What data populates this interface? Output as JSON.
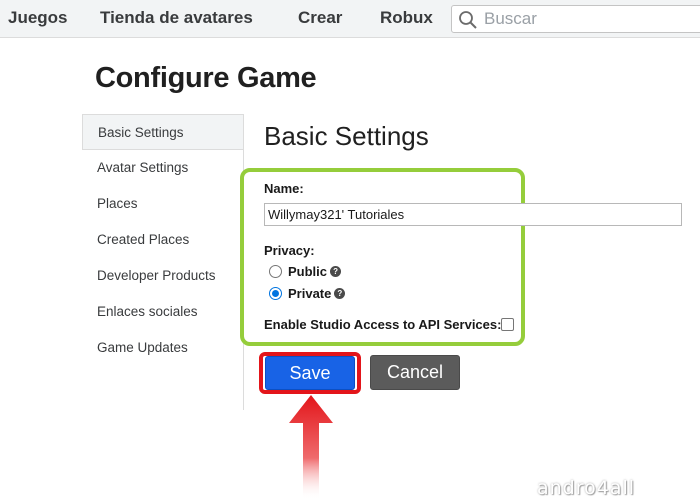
{
  "nav": {
    "items": [
      "Juegos",
      "Tienda de avatares",
      "Crear",
      "Robux"
    ],
    "search_placeholder": "Buscar"
  },
  "page_title": "Configure Game",
  "menu": {
    "items": [
      {
        "label": "Basic Settings",
        "active": true
      },
      {
        "label": "Avatar Settings",
        "active": false
      },
      {
        "label": "Places",
        "active": false
      },
      {
        "label": "Created Places",
        "active": false
      },
      {
        "label": "Developer Products",
        "active": false
      },
      {
        "label": "Enlaces sociales",
        "active": false
      },
      {
        "label": "Game Updates",
        "active": false
      }
    ]
  },
  "section_title": "Basic Settings",
  "form": {
    "name_label": "Name:",
    "name_value": "Willymay321' Tutoriales",
    "privacy_label": "Privacy:",
    "privacy_options": [
      {
        "label": "Public",
        "checked": false
      },
      {
        "label": "Private",
        "checked": true
      }
    ],
    "api_label": "Enable Studio Access to API Services:",
    "api_checked": false
  },
  "buttons": {
    "save": "Save",
    "cancel": "Cancel"
  },
  "colors": {
    "highlight_green": "#95cd3b",
    "highlight_red": "#e3151a",
    "save_blue": "#1863e6",
    "cancel_gray": "#5b5b5b"
  },
  "watermark": "andro4all"
}
